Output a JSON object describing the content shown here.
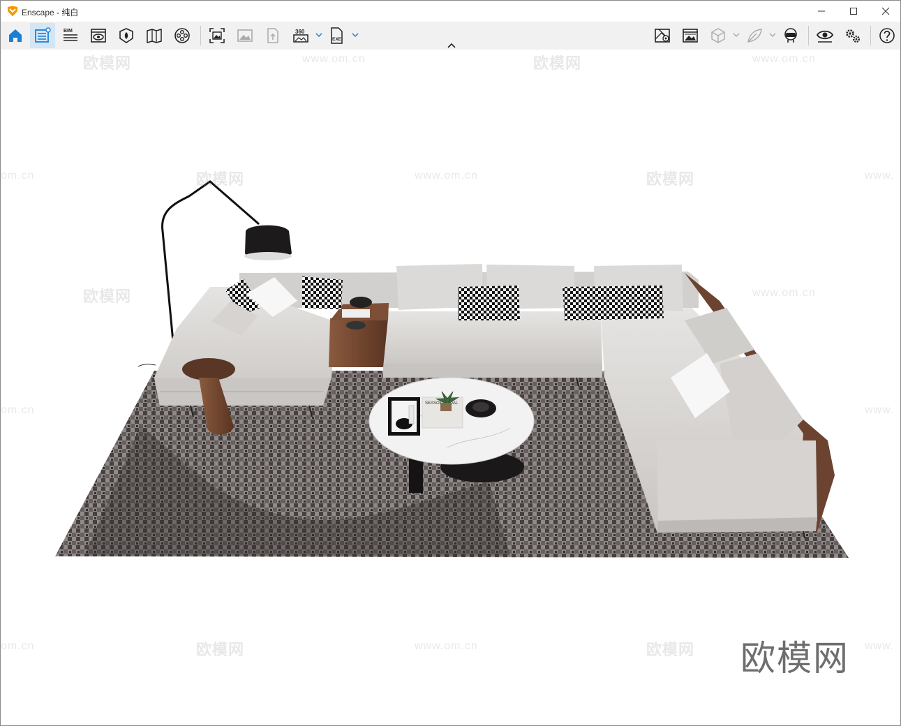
{
  "window": {
    "app_name": "Enscape",
    "title_separator": " - ",
    "document": "纯白",
    "brand_color": "#f39800",
    "controls": [
      "minimize-icon",
      "maximize-icon",
      "close-icon"
    ]
  },
  "toolbar": {
    "bim_label": "BIM",
    "video_360_label": "360",
    "exe_label": "EXE",
    "accent_color": "#1c7fd1",
    "left_tools": [
      {
        "name": "home-icon",
        "active": false
      },
      {
        "name": "asset-library-icon",
        "active": true
      },
      {
        "name": "bim-icon",
        "active": false
      },
      {
        "name": "visual-settings-icon",
        "active": false
      },
      {
        "name": "materials-icon",
        "active": false
      },
      {
        "name": "views-icon",
        "active": false
      },
      {
        "name": "video-editor-icon",
        "active": false
      },
      {
        "name": "screenshot-icon",
        "active": false
      },
      {
        "name": "render-image-icon",
        "active": false
      },
      {
        "name": "upload-icon",
        "active": false
      },
      {
        "name": "panorama-360-icon",
        "active": false
      },
      {
        "name": "export-exe-icon",
        "active": false
      }
    ],
    "right_tools": [
      {
        "name": "map-icon"
      },
      {
        "name": "batch-render-icon"
      },
      {
        "name": "orthographic-cube-icon"
      },
      {
        "name": "leaf-icon"
      },
      {
        "name": "vr-headset-icon"
      },
      {
        "name": "eye-icon"
      },
      {
        "name": "settings-gears-icon"
      },
      {
        "name": "help-icon"
      }
    ],
    "collapse_icon": "chevron-up-icon"
  },
  "watermarks": {
    "logo_text": "欧模网",
    "url_text": "www.om.cn",
    "url_fragment": "om.cn",
    "url_prefix": "www."
  },
  "scene": {
    "description_objects": [
      "floor-lamp",
      "sectional-sofa",
      "side-table",
      "coffee-table",
      "area-rug"
    ],
    "book_title": "SEASON MEDAL",
    "colors": {
      "fabric": "#d8d6d4",
      "wood": "#6b4330",
      "rug_dark": "#3e3a38",
      "rug_light": "#bdb6b2",
      "marble": "#f2f2f2"
    }
  }
}
